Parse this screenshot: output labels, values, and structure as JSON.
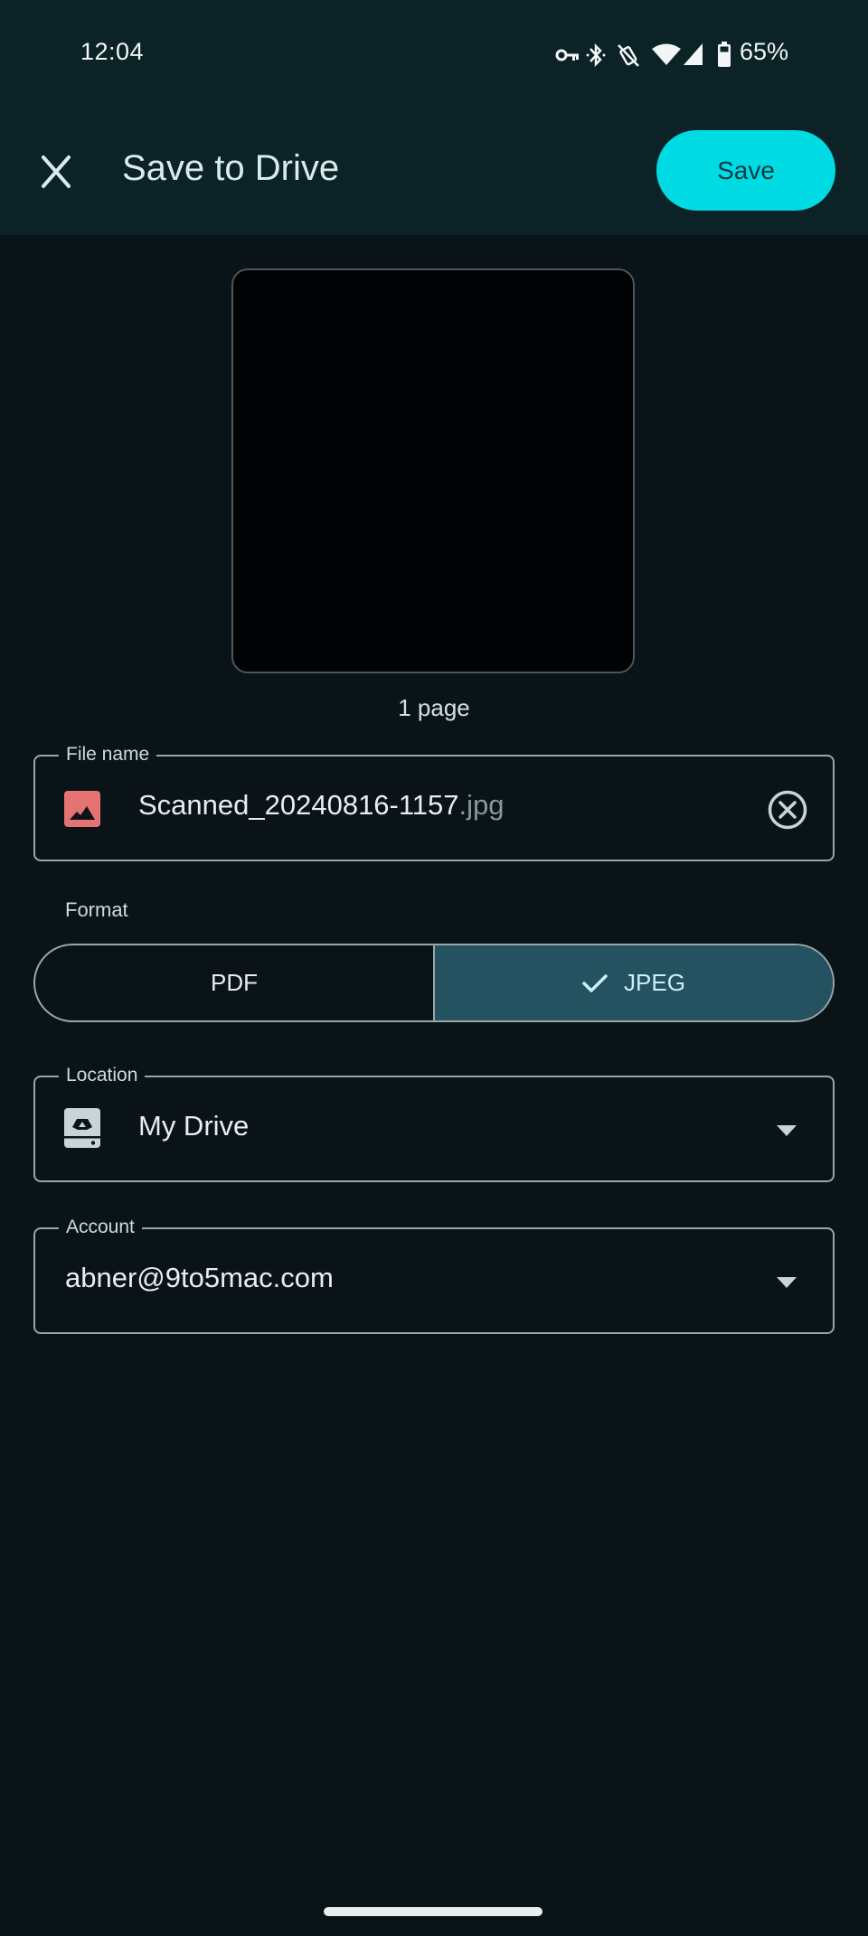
{
  "status_bar": {
    "time": "12:04",
    "battery_percent": "65%",
    "icons": [
      "vpn-key-icon",
      "bluetooth-icon",
      "vibrate-off-icon",
      "wifi-icon",
      "cell-signal-icon",
      "battery-icon"
    ]
  },
  "header": {
    "close_icon": "close-icon",
    "title": "Save to Drive",
    "save_label": "Save"
  },
  "preview": {
    "page_count": "1 page"
  },
  "file_name": {
    "label": "File name",
    "value_base": "Scanned_20240816-1157",
    "value_ext": ".jpg",
    "leading_icon": "image-icon",
    "trailing_icon": "clear-circle-icon"
  },
  "format": {
    "label": "Format",
    "options": [
      {
        "label": "PDF",
        "selected": false
      },
      {
        "label": "JPEG",
        "selected": true
      }
    ]
  },
  "location": {
    "label": "Location",
    "value": "My Drive",
    "leading_icon": "drive-icon"
  },
  "account": {
    "label": "Account",
    "value": "abner@9to5mac.com"
  },
  "colors": {
    "accent": "#00dbe3",
    "header_bg": "#0b2226",
    "body_bg": "#0a1418",
    "selected_segment": "#245260",
    "image_icon": "#e57373"
  }
}
